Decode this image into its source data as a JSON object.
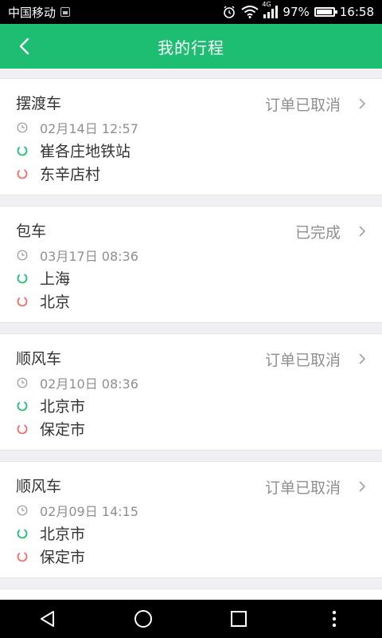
{
  "status_bar": {
    "carrier": "中国移动",
    "network": "4G",
    "battery": "97%",
    "battery_level": 0.97,
    "time": "16:58"
  },
  "header": {
    "title": "我的行程",
    "back_icon": "chevron-left-icon"
  },
  "trips": [
    {
      "type": "摆渡车",
      "status": "订单已取消",
      "time": "02月14日 12:57",
      "from": "崔各庄地铁站",
      "to": "东辛店村"
    },
    {
      "type": "包车",
      "status": "已完成",
      "time": "03月17日 08:36",
      "from": "上海",
      "to": "北京"
    },
    {
      "type": "顺风车",
      "status": "订单已取消",
      "time": "02月10日 08:36",
      "from": "北京市",
      "to": "保定市"
    },
    {
      "type": "顺风车",
      "status": "订单已取消",
      "time": "02月09日 14:15",
      "from": "北京市",
      "to": "保定市"
    }
  ],
  "colors": {
    "accent": "#1ebe72",
    "origin": "#1ebe72",
    "destination": "#f26a6a"
  },
  "nav_bar": {
    "icons": [
      "back-triangle-icon",
      "home-circle-icon",
      "recents-square-icon",
      "menu-dots-icon"
    ]
  }
}
